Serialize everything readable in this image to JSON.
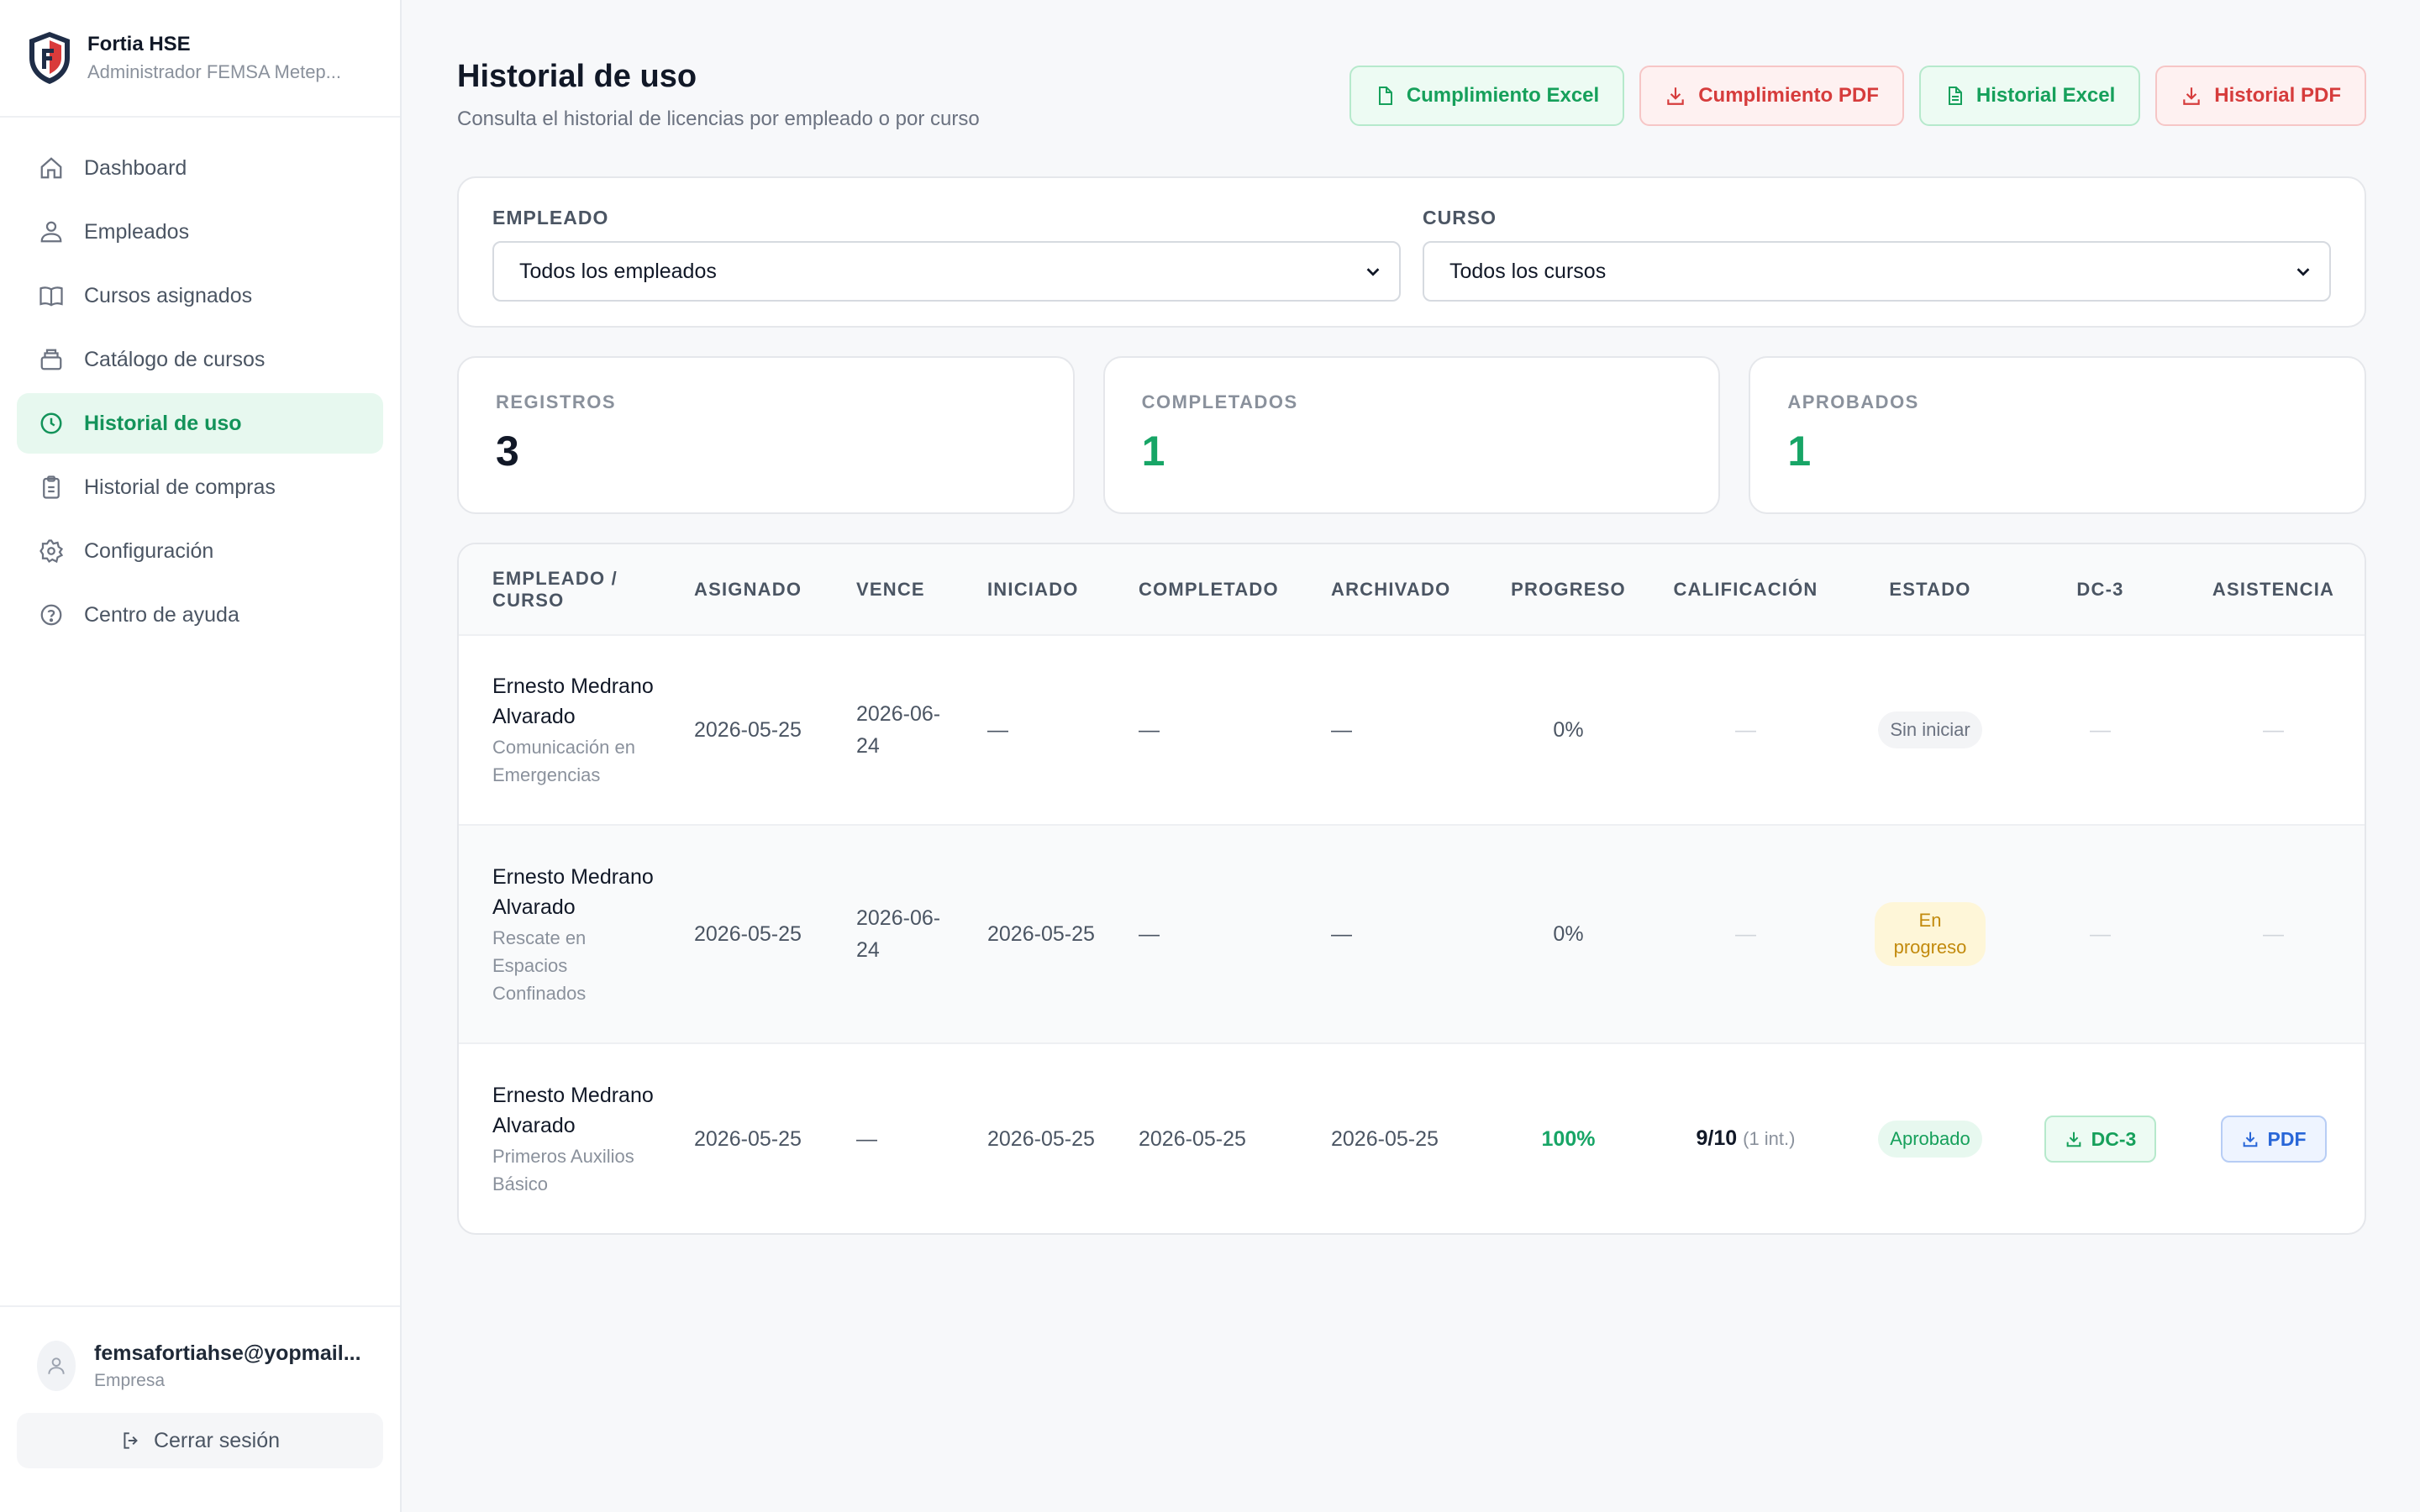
{
  "brand": {
    "name": "Fortia HSE",
    "subtitle": "Administrador FEMSA Metep..."
  },
  "nav": [
    {
      "label": "Dashboard",
      "icon": "home-icon"
    },
    {
      "label": "Empleados",
      "icon": "users-icon"
    },
    {
      "label": "Cursos asignados",
      "icon": "book-icon"
    },
    {
      "label": "Catálogo de cursos",
      "icon": "catalog-icon"
    },
    {
      "label": "Historial de uso",
      "icon": "clock-icon",
      "active": true
    },
    {
      "label": "Historial de compras",
      "icon": "clipboard-icon"
    },
    {
      "label": "Configuración",
      "icon": "gear-icon"
    },
    {
      "label": "Centro de ayuda",
      "icon": "help-icon"
    }
  ],
  "user": {
    "email": "femsafortiahse@yopmail...",
    "role": "Empresa",
    "logout_label": "Cerrar sesión"
  },
  "page": {
    "title": "Historial de uso",
    "subtitle": "Consulta el historial de licencias por empleado o por curso"
  },
  "actions": {
    "cumplimiento_excel": "Cumplimiento Excel",
    "cumplimiento_pdf": "Cumplimiento PDF",
    "historial_excel": "Historial Excel",
    "historial_pdf": "Historial PDF"
  },
  "filters": {
    "employee_label": "EMPLEADO",
    "employee_value": "Todos los empleados",
    "course_label": "CURSO",
    "course_value": "Todos los cursos"
  },
  "stats": {
    "registros": {
      "label": "REGISTROS",
      "value": "3"
    },
    "completados": {
      "label": "COMPLETADOS",
      "value": "1"
    },
    "aprobados": {
      "label": "APROBADOS",
      "value": "1"
    }
  },
  "table": {
    "headers": {
      "empleado": "EMPLEADO / CURSO",
      "asignado": "ASIGNADO",
      "vence": "VENCE",
      "iniciado": "INICIADO",
      "completado": "COMPLETADO",
      "archivado": "ARCHIVADO",
      "progreso": "PROGRESO",
      "calificacion": "CALIFICACIÓN",
      "estado": "ESTADO",
      "dc3": "DC-3",
      "asistencia": "ASISTENCIA"
    },
    "rows": [
      {
        "name": "Ernesto Medrano Alvarado",
        "course": "Comunicación en Emergencias",
        "asignado": "2026-05-25",
        "vence": "2026-06-24",
        "iniciado": "—",
        "completado": "—",
        "archivado": "—",
        "progreso": "0%",
        "calificacion": "—",
        "estado": "Sin iniciar",
        "dc3": "—",
        "asistencia": "—"
      },
      {
        "name": "Ernesto Medrano Alvarado",
        "course": "Rescate en Espacios Confinados",
        "asignado": "2026-05-25",
        "vence": "2026-06-24",
        "iniciado": "2026-05-25",
        "completado": "—",
        "archivado": "—",
        "progreso": "0%",
        "calificacion": "—",
        "estado": "En progreso",
        "dc3": "—",
        "asistencia": "—"
      },
      {
        "name": "Ernesto Medrano Alvarado",
        "course": "Primeros Auxilios Básico",
        "asignado": "2026-05-25",
        "vence": "—",
        "iniciado": "2026-05-25",
        "completado": "2026-05-25",
        "archivado": "2026-05-25",
        "progreso": "100%",
        "calificacion": "9/10",
        "calificacion_sub": "(1 int.)",
        "estado": "Aprobado",
        "dc3": "DC-3",
        "asistencia": "PDF"
      }
    ]
  },
  "colors": {
    "accent_green": "#16a05b",
    "accent_red": "#d63c3c",
    "accent_blue": "#2866d8",
    "warning_yellow": "#c28a0d"
  }
}
